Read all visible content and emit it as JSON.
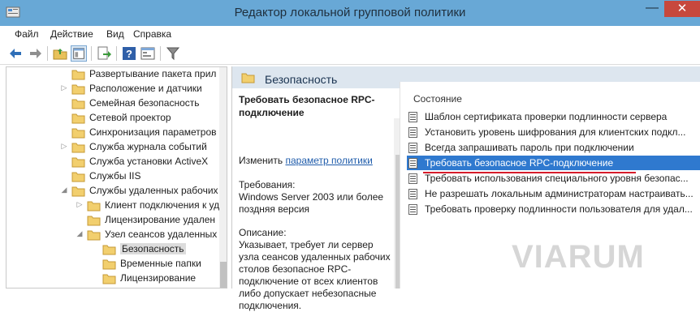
{
  "window": {
    "title": "Редактор локальной групповой политики",
    "minimize": "—",
    "close": "✕"
  },
  "menu": [
    "Файл",
    "Действие",
    "Вид",
    "Справка"
  ],
  "toolbar": {
    "icons": [
      "arrow-back-icon",
      "arrow-forward-icon",
      "up-folder-icon",
      "show-tree-icon",
      "export-list-icon",
      "help-icon",
      "properties-icon",
      "filter-icon"
    ]
  },
  "tree": {
    "items": [
      {
        "label": "Развертывание пакета прил",
        "expandable": false
      },
      {
        "label": "Расположение и датчики",
        "expandable": true
      },
      {
        "label": "Семейная безопасность",
        "expandable": false
      },
      {
        "label": "Сетевой проектор",
        "expandable": false
      },
      {
        "label": "Синхронизация параметров",
        "expandable": false
      },
      {
        "label": "Служба журнала событий",
        "expandable": true
      },
      {
        "label": "Служба установки ActiveX",
        "expandable": false
      },
      {
        "label": "Службы IIS",
        "expandable": false
      },
      {
        "label": "Службы удаленных рабочих",
        "expandable": true,
        "expanded": true
      },
      {
        "label": "Клиент подключения к уд",
        "expandable": true
      },
      {
        "label": "Лицензирование удален",
        "expandable": false
      },
      {
        "label": "Узел сеансов удаленных",
        "expandable": true,
        "expanded": true
      },
      {
        "label": "Безопасность",
        "expandable": false,
        "selected": true
      },
      {
        "label": "Временные папки",
        "expandable": false
      },
      {
        "label": "Лицензирование",
        "expandable": false
      }
    ]
  },
  "section": {
    "title": "Безопасность"
  },
  "description": {
    "title": "Требовать безопасное RPC-подключение",
    "edit_prefix": "Изменить",
    "edit_link": "параметр политики",
    "requirements_label": "Требования:",
    "requirements_value": "Windows Server 2003 или более поздняя версия",
    "description_label": "Описание:",
    "description_value": "Указывает, требует ли сервер узла сеансов удаленных рабочих столов безопасное RPC-подключение от всех клиентов либо допускает небезопасные подключения."
  },
  "settings": {
    "column_header": "Состояние",
    "items": [
      {
        "label": "Шаблон сертификата проверки подлинности сервера"
      },
      {
        "label": "Установить уровень шифрования для клиентских подкл..."
      },
      {
        "label": "Всегда запрашивать пароль при подключении"
      },
      {
        "label": "Требовать безопасное RPC-подключение",
        "selected": true
      },
      {
        "label": "Требовать использования специального уровня безопас..."
      },
      {
        "label": "Не разрешать локальным администраторам настраивать..."
      },
      {
        "label": "Требовать проверку подлинности пользователя для удал..."
      }
    ]
  },
  "watermark": "VIARUM",
  "colors": {
    "titlebar": "#68a8d6",
    "close_button": "#c7483d",
    "selection": "#2f79cf",
    "section_header": "#dde6ef",
    "annotation_underline": "#d61c2a"
  }
}
